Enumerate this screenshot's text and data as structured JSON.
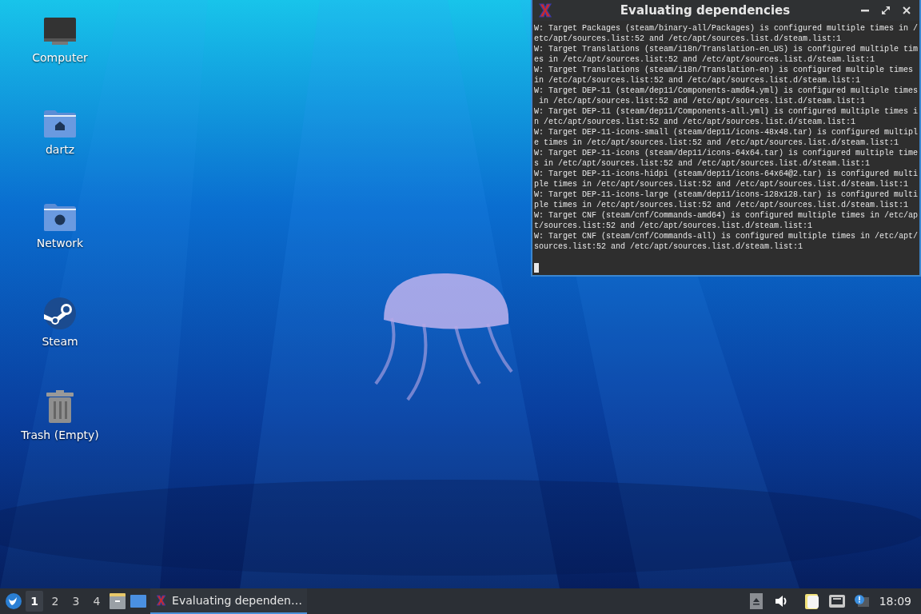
{
  "desktop_icons": [
    {
      "kind": "computer",
      "label": "Computer"
    },
    {
      "kind": "home",
      "label": "dartz"
    },
    {
      "kind": "network",
      "label": "Network"
    },
    {
      "kind": "steam",
      "label": "Steam"
    },
    {
      "kind": "trash",
      "label": "Trash (Empty)"
    }
  ],
  "window": {
    "title": "Evaluating dependencies",
    "lines": [
      "W: Target Packages (steam/binary-all/Packages) is configured multiple times in /",
      "etc/apt/sources.list:52 and /etc/apt/sources.list.d/steam.list:1",
      "W: Target Translations (steam/i18n/Translation-en_US) is configured multiple tim",
      "es in /etc/apt/sources.list:52 and /etc/apt/sources.list.d/steam.list:1",
      "W: Target Translations (steam/i18n/Translation-en) is configured multiple times",
      "in /etc/apt/sources.list:52 and /etc/apt/sources.list.d/steam.list:1",
      "W: Target DEP-11 (steam/dep11/Components-amd64.yml) is configured multiple times",
      " in /etc/apt/sources.list:52 and /etc/apt/sources.list.d/steam.list:1",
      "W: Target DEP-11 (steam/dep11/Components-all.yml) is configured multiple times i",
      "n /etc/apt/sources.list:52 and /etc/apt/sources.list.d/steam.list:1",
      "W: Target DEP-11-icons-small (steam/dep11/icons-48x48.tar) is configured multipl",
      "e times in /etc/apt/sources.list:52 and /etc/apt/sources.list.d/steam.list:1",
      "W: Target DEP-11-icons (steam/dep11/icons-64x64.tar) is configured multiple time",
      "s in /etc/apt/sources.list:52 and /etc/apt/sources.list.d/steam.list:1",
      "W: Target DEP-11-icons-hidpi (steam/dep11/icons-64x64@2.tar) is configured multi",
      "ple times in /etc/apt/sources.list:52 and /etc/apt/sources.list.d/steam.list:1",
      "W: Target DEP-11-icons-large (steam/dep11/icons-128x128.tar) is configured multi",
      "ple times in /etc/apt/sources.list:52 and /etc/apt/sources.list.d/steam.list:1",
      "W: Target CNF (steam/cnf/Commands-amd64) is configured multiple times in /etc/ap",
      "t/sources.list:52 and /etc/apt/sources.list.d/steam.list:1",
      "W: Target CNF (steam/cnf/Commands-all) is configured multiple times in /etc/apt/",
      "sources.list:52 and /etc/apt/sources.list.d/steam.list:1"
    ]
  },
  "taskbar": {
    "workspaces": [
      {
        "label": "1",
        "selected": true
      },
      {
        "label": "2",
        "selected": false
      },
      {
        "label": "3",
        "selected": false
      },
      {
        "label": "4",
        "selected": false
      }
    ],
    "tasks": [
      {
        "label": "Evaluating dependen…",
        "selected": true
      }
    ],
    "clock": "18:09"
  }
}
